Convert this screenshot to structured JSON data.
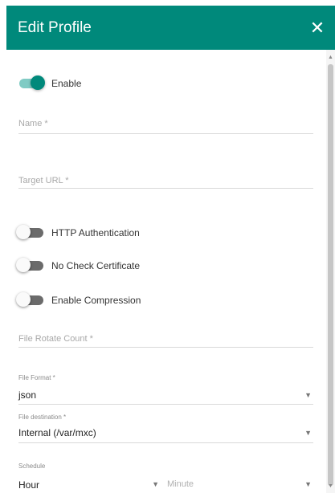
{
  "dialog": {
    "title": "Edit Profile",
    "close_glyph": "✕"
  },
  "toggles": {
    "enable": {
      "label": "Enable",
      "on": true
    },
    "http_auth": {
      "label": "HTTP Authentication",
      "on": false
    },
    "no_check_cert": {
      "label": "No Check Certificate",
      "on": false
    },
    "compression": {
      "label": "Enable Compression",
      "on": false
    }
  },
  "fields": {
    "name": {
      "placeholder": "Name *"
    },
    "target_url": {
      "placeholder": "Target URL *"
    },
    "file_rotate_count": {
      "placeholder": "File Rotate Count *"
    }
  },
  "selects": {
    "file_format": {
      "label": "File Format *",
      "value": "json"
    },
    "file_destination": {
      "label": "File destination *",
      "value": "Internal (/var/mxc)"
    },
    "schedule": {
      "label": "Schedule",
      "value": "Hour"
    },
    "minute": {
      "placeholder": "Minute"
    }
  },
  "colors": {
    "accent": "#00897b",
    "toggle_track_on": "#80cbc4",
    "toggle_track_off": "#6b6b6b"
  },
  "icons": {
    "close": "close-icon",
    "caret": "chevron-down-icon"
  }
}
